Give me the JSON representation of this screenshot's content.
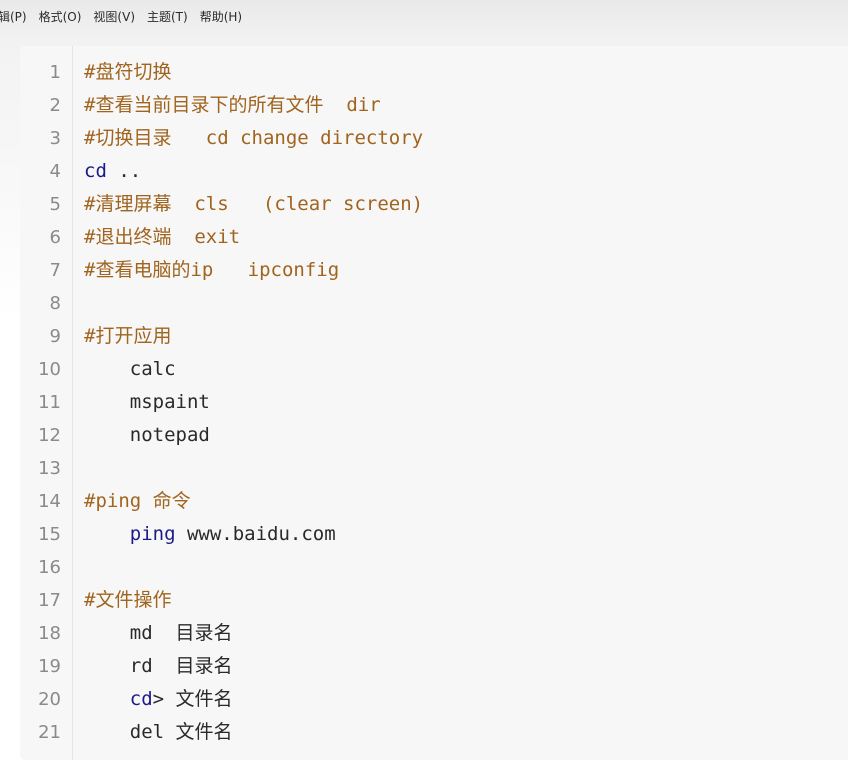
{
  "menu": [
    {
      "label": "辑(P)"
    },
    {
      "label": "格式(O)"
    },
    {
      "label": "视图(V)"
    },
    {
      "label": "主题(T)"
    },
    {
      "label": "帮助(H)"
    }
  ],
  "theme": {
    "comment_color": "#a0641e",
    "command_color": "#1c1a8a",
    "text_color": "#2a2a2a",
    "line_number_color": "#8a8a8a"
  },
  "editor": {
    "lines": [
      {
        "num": "1",
        "indent": "",
        "tokens": [
          {
            "t": "comment",
            "text": "#盘符切换"
          }
        ]
      },
      {
        "num": "2",
        "indent": "",
        "tokens": [
          {
            "t": "comment",
            "text": "#查看当前目录下的所有文件  dir"
          }
        ]
      },
      {
        "num": "3",
        "indent": "",
        "tokens": [
          {
            "t": "comment",
            "text": "#切换目录   cd change directory"
          }
        ]
      },
      {
        "num": "4",
        "indent": "",
        "tokens": [
          {
            "t": "cmd",
            "text": "cd"
          },
          {
            "t": "plain",
            "text": " .."
          }
        ]
      },
      {
        "num": "5",
        "indent": "",
        "tokens": [
          {
            "t": "comment",
            "text": "#清理屏幕  cls   (clear screen)"
          }
        ]
      },
      {
        "num": "6",
        "indent": "",
        "tokens": [
          {
            "t": "comment",
            "text": "#退出终端  exit"
          }
        ]
      },
      {
        "num": "7",
        "indent": "",
        "tokens": [
          {
            "t": "comment",
            "text": "#查看电脑的ip   ipconfig"
          }
        ]
      },
      {
        "num": "8",
        "indent": "",
        "tokens": []
      },
      {
        "num": "9",
        "indent": "",
        "tokens": [
          {
            "t": "comment",
            "text": "#打开应用"
          }
        ]
      },
      {
        "num": "10",
        "indent": "    ",
        "tokens": [
          {
            "t": "plain",
            "text": "calc"
          }
        ]
      },
      {
        "num": "11",
        "indent": "    ",
        "tokens": [
          {
            "t": "plain",
            "text": "mspaint"
          }
        ]
      },
      {
        "num": "12",
        "indent": "    ",
        "tokens": [
          {
            "t": "plain",
            "text": "notepad"
          }
        ]
      },
      {
        "num": "13",
        "indent": "",
        "tokens": []
      },
      {
        "num": "14",
        "indent": "",
        "tokens": [
          {
            "t": "comment",
            "text": "#ping 命令"
          }
        ]
      },
      {
        "num": "15",
        "indent": "    ",
        "tokens": [
          {
            "t": "cmd",
            "text": "ping"
          },
          {
            "t": "plain",
            "text": " www.baidu.com"
          }
        ]
      },
      {
        "num": "16",
        "indent": "",
        "tokens": []
      },
      {
        "num": "17",
        "indent": "",
        "tokens": [
          {
            "t": "comment",
            "text": "#文件操作"
          }
        ]
      },
      {
        "num": "18",
        "indent": "    ",
        "tokens": [
          {
            "t": "plain",
            "text": "md  目录名"
          }
        ]
      },
      {
        "num": "19",
        "indent": "    ",
        "tokens": [
          {
            "t": "plain",
            "text": "rd  目录名"
          }
        ]
      },
      {
        "num": "20",
        "indent": "    ",
        "tokens": [
          {
            "t": "cmd",
            "text": "cd"
          },
          {
            "t": "plain",
            "text": "> 文件名"
          }
        ]
      },
      {
        "num": "21",
        "indent": "    ",
        "tokens": [
          {
            "t": "plain",
            "text": "del 文件名"
          }
        ]
      }
    ]
  }
}
